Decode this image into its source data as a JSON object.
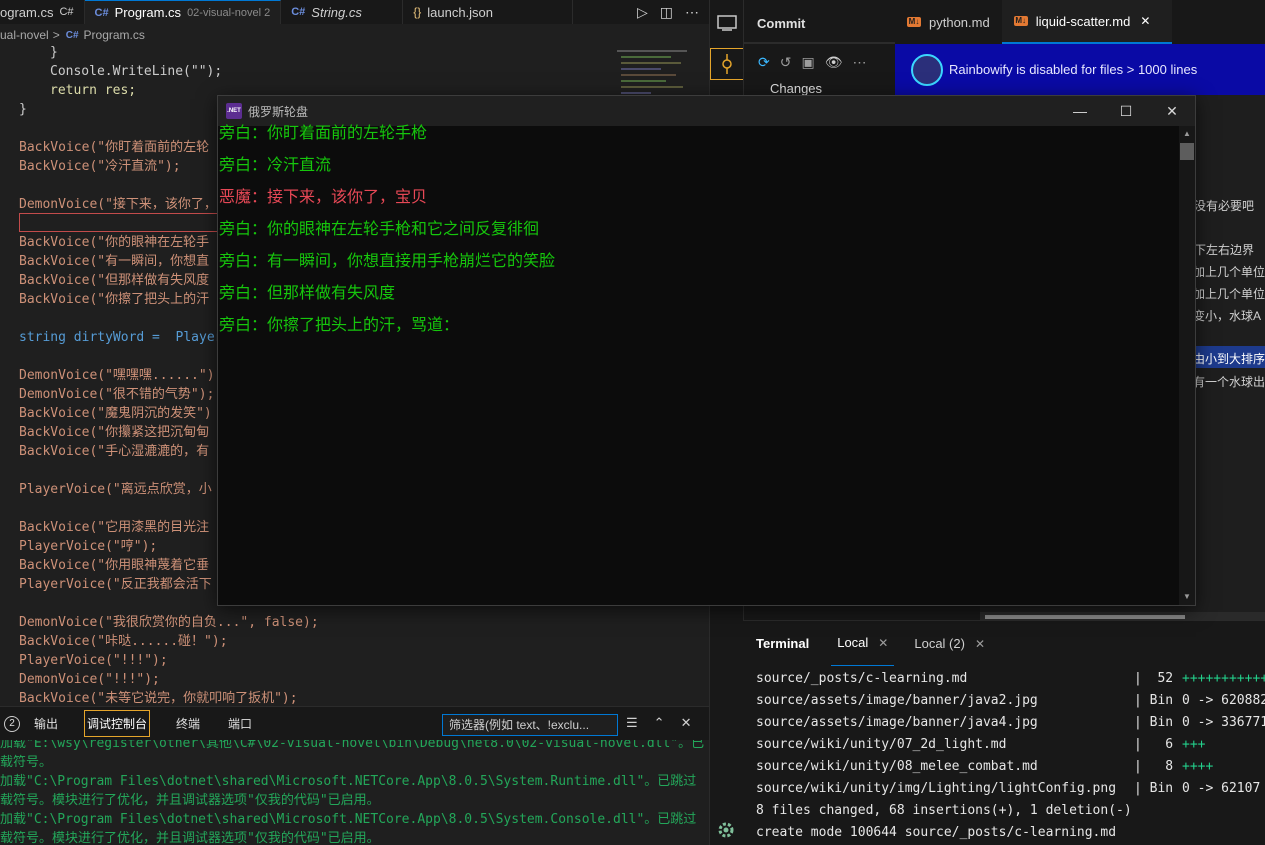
{
  "editor": {
    "tabs": [
      {
        "label": "ogram.cs",
        "lang": "C#",
        "sub": ""
      },
      {
        "label": "Program.cs",
        "lang": "C#",
        "sub": "02-visual-novel 2"
      },
      {
        "label": "String.cs",
        "lang": "C#",
        "sub": ""
      },
      {
        "label": "launch.json",
        "lang": "{}",
        "sub": ""
      }
    ],
    "breadcrumb": [
      "ual-novel",
      "Program.cs"
    ],
    "breadcrumb_sep": ">",
    "code_lines": [
      "}",
      "Console.WriteLine(\"\");",
      "return res;",
      "}",
      "BackVoice(\"你盯着面前的左轮",
      "BackVoice(\"冷汗直流\");",
      "DemonVoice(\"接下来，该你了，",
      "BackVoice(\"你的眼神在左轮手",
      "BackVoice(\"有一瞬间，你想直",
      "BackVoice(\"但那样做有失风度",
      "BackVoice(\"你擦了把头上的汗",
      "string dirtyWord =  Player",
      "DemonVoice(\"嘿嘿嘿......\")",
      "DemonVoice(\"很不错的气势\");",
      "BackVoice(\"魔鬼阴沉的发笑\")",
      "BackVoice(\"你攥紧这把沉甸甸",
      "BackVoice(\"手心湿漉漉的，有",
      "PlayerVoice(\"离远点欣赏，小",
      "BackVoice(\"它用漆黑的目光注",
      "PlayerVoice(\"哼\");",
      "BackVoice(\"你用眼神蔑着它垂",
      "PlayerVoice(\"反正我都会活下",
      "DemonVoice(\"我很欣赏你的自负...\", false);",
      "BackVoice(\"咔哒......碰！\");",
      "PlayerVoice(\"!!!\");",
      "DemonVoice(\"!!!\");",
      "BackVoice(\"未等它说完，你就叩响了扳机\");"
    ]
  },
  "panel": {
    "count": "2",
    "tabs": [
      "输出",
      "调试控制台",
      "终端",
      "端口"
    ],
    "active_tab": "调试控制台",
    "filter_placeholder": "筛选器(例如 text、!exclu...",
    "output_lines": [
      "加载\"E:\\wsy\\register\\other\\其他\\C#\\02-visual-novel\\bin\\Debug\\net8.0\\02-visual-novel.dll\"。已",
      "载符号。",
      "加载\"C:\\Program Files\\dotnet\\shared\\Microsoft.NETCore.App\\8.0.5\\System.Runtime.dll\"。已跳过",
      "载符号。模块进行了优化，并且调试器选项\"仅我的代码\"已启用。",
      "加载\"C:\\Program Files\\dotnet\\shared\\Microsoft.NETCore.App\\8.0.5\\System.Console.dll\"。已跳过",
      "载符号。模块进行了优化，并且调试器选项\"仅我的代码\"已启用。"
    ]
  },
  "scm": {
    "title": "Commit",
    "changes_label": "Changes"
  },
  "right_tabs": [
    {
      "label": "python.md",
      "active": false
    },
    {
      "label": "liquid-scatter.md",
      "active": true
    }
  ],
  "banner": {
    "text": "Rainbowify is disabled for files > 1000 lines"
  },
  "markdown_fragments": [
    "是没有必要吧",
    "上下左右边界",
    "加上几个单位",
    "加上几个单位",
    "变小，水球A",
    "由小到大排序",
    "有一个水球出"
  ],
  "terminal": {
    "title": "Terminal",
    "tabs": [
      "Local",
      "Local (2)"
    ],
    "lines": [
      {
        "path": "source/_posts/c-learning.md",
        "col": "|  52 ",
        "stat": "+++++++++++",
        "kind": "plus"
      },
      {
        "path": "source/assets/image/banner/java2.jpg",
        "col": "| Bin ",
        "stat": "0 -> 620882",
        "kind": "bin"
      },
      {
        "path": "source/assets/image/banner/java4.jpg",
        "col": "| Bin ",
        "stat": "0 -> 336771",
        "kind": "bin"
      },
      {
        "path": "source/wiki/unity/07_2d_light.md",
        "col": "|   6 ",
        "stat": "+++",
        "kind": "plus"
      },
      {
        "path": "source/wiki/unity/08_melee_combat.md",
        "col": "|   8 ",
        "stat": "++++",
        "kind": "plus"
      },
      {
        "path": "source/wiki/unity/img/Lighting/lightConfig.png",
        "col": "| Bin ",
        "stat": "0 -> 62107",
        "kind": "bin"
      }
    ],
    "summary": "8 files changed, 68 insertions(+), 1 deletion(-)",
    "create": "create mode 100644 source/_posts/c-learning.md"
  },
  "console": {
    "icon_text": ".NET",
    "title": "俄罗斯轮盘",
    "lines": [
      {
        "text": "旁白：你盯着面前的左轮手枪",
        "color": "#16c60c"
      },
      {
        "text": "旁白：冷汗直流",
        "color": "#16c60c"
      },
      {
        "text": "恶魔：接下来，该你了，宝贝",
        "color": "#e74856"
      },
      {
        "text": "旁白：你的眼神在左轮手枪和它之间反复徘徊",
        "color": "#16c60c"
      },
      {
        "text": "旁白：有一瞬间，你想直接用手枪崩烂它的笑脸",
        "color": "#16c60c"
      },
      {
        "text": "旁白：但那样做有失风度",
        "color": "#16c60c"
      },
      {
        "text": "旁白：你擦了把头上的汗，骂道：",
        "color": "#16c60c"
      }
    ]
  }
}
